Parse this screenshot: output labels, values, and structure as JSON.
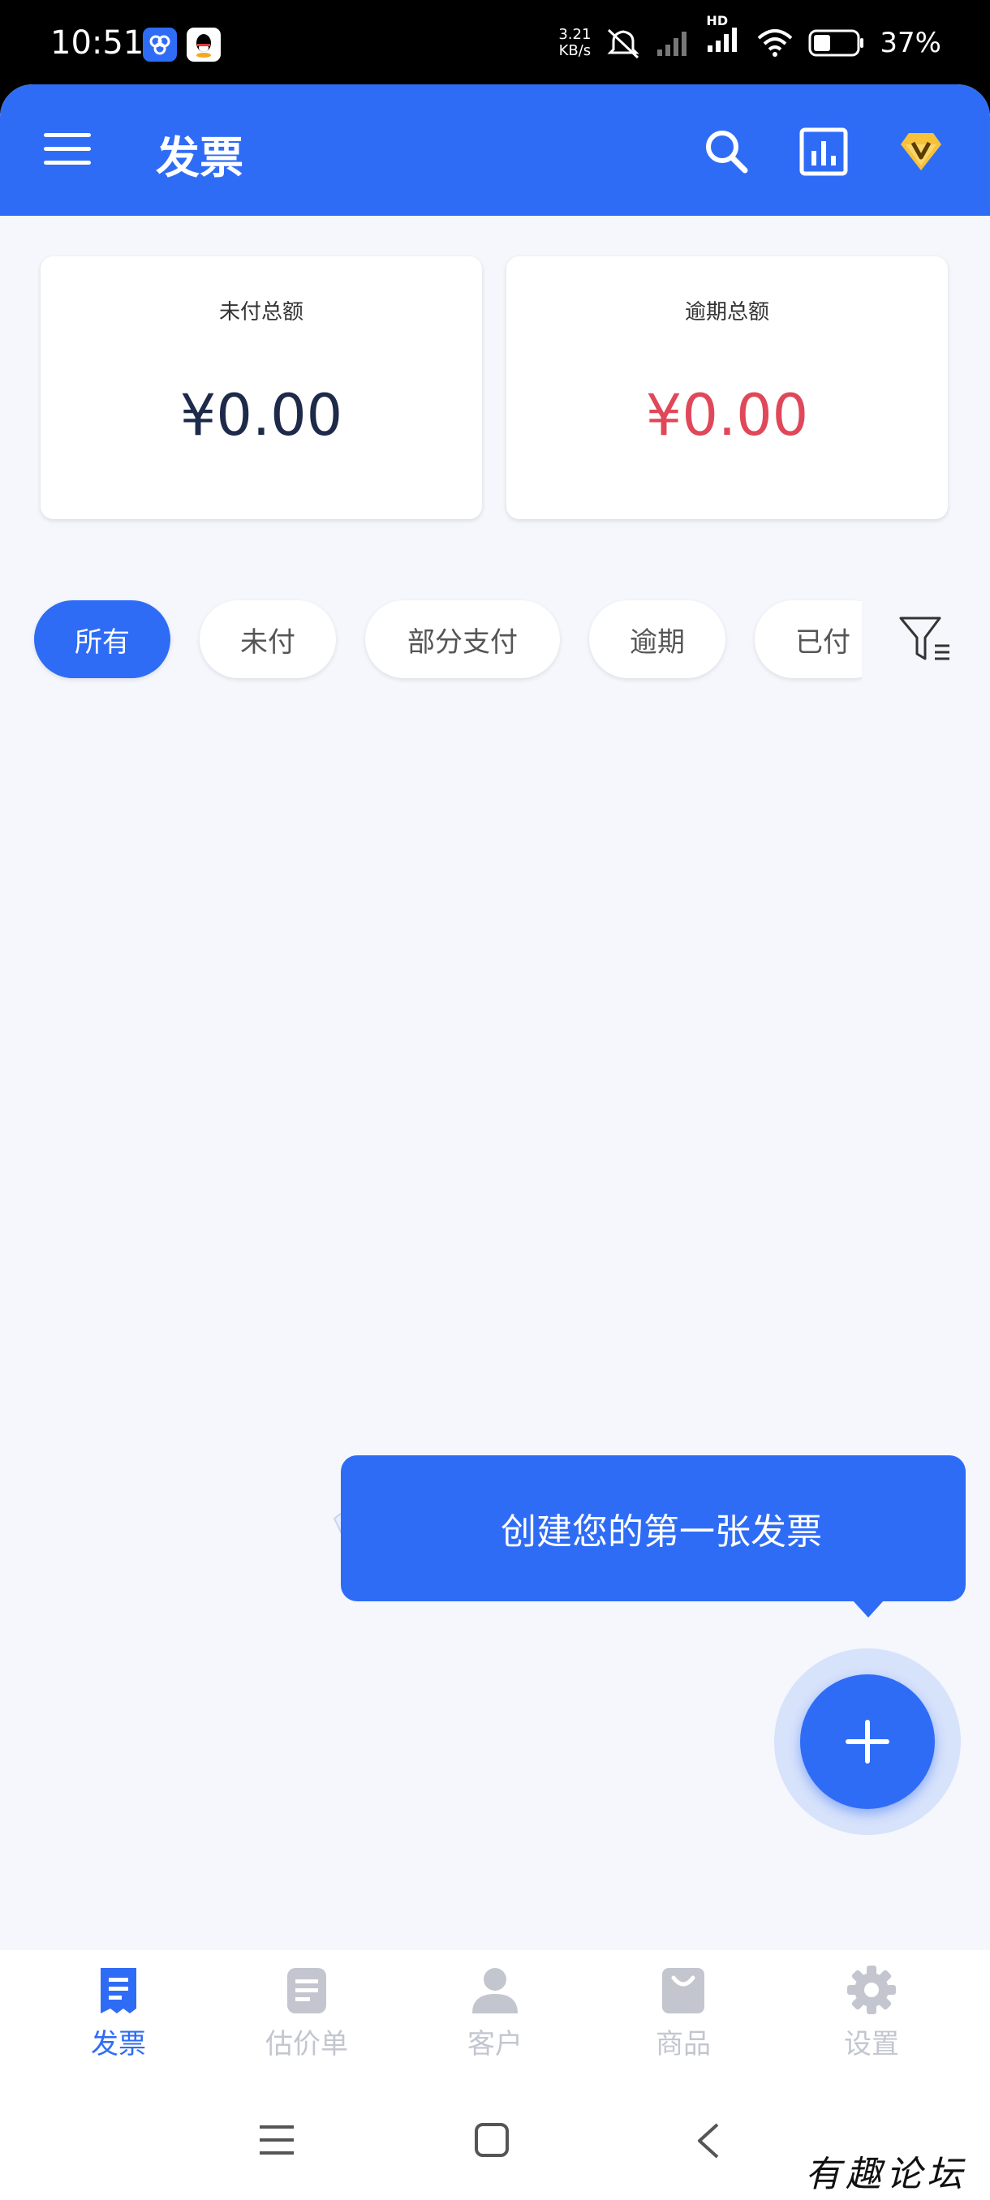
{
  "status_bar": {
    "time": "10:51",
    "speed_value": "3.21",
    "speed_unit": "KB/s",
    "network": "HD",
    "battery": "37%"
  },
  "header": {
    "title": "发票",
    "icons": [
      "menu-icon",
      "search-icon",
      "chart-icon",
      "vip-icon"
    ]
  },
  "summary": {
    "unpaid_label": "未付总额",
    "unpaid_value": "¥0.00",
    "overdue_label": "逾期总额",
    "overdue_value": "¥0.00"
  },
  "filters": {
    "chips": [
      "所有",
      "未付",
      "部分支付",
      "逾期",
      "已付"
    ],
    "active": "所有"
  },
  "tooltip": {
    "text": "创建您的第一张发票"
  },
  "bottom_nav": {
    "items": [
      "发票",
      "估价单",
      "客户",
      "商品",
      "设置"
    ],
    "active": "发票"
  },
  "watermark": "有趣论坛",
  "colors": {
    "primary": "#2f6cf6",
    "overdue": "#e0485a",
    "unpaid": "#1e2a4a",
    "inactive": "#c3c6cf"
  }
}
